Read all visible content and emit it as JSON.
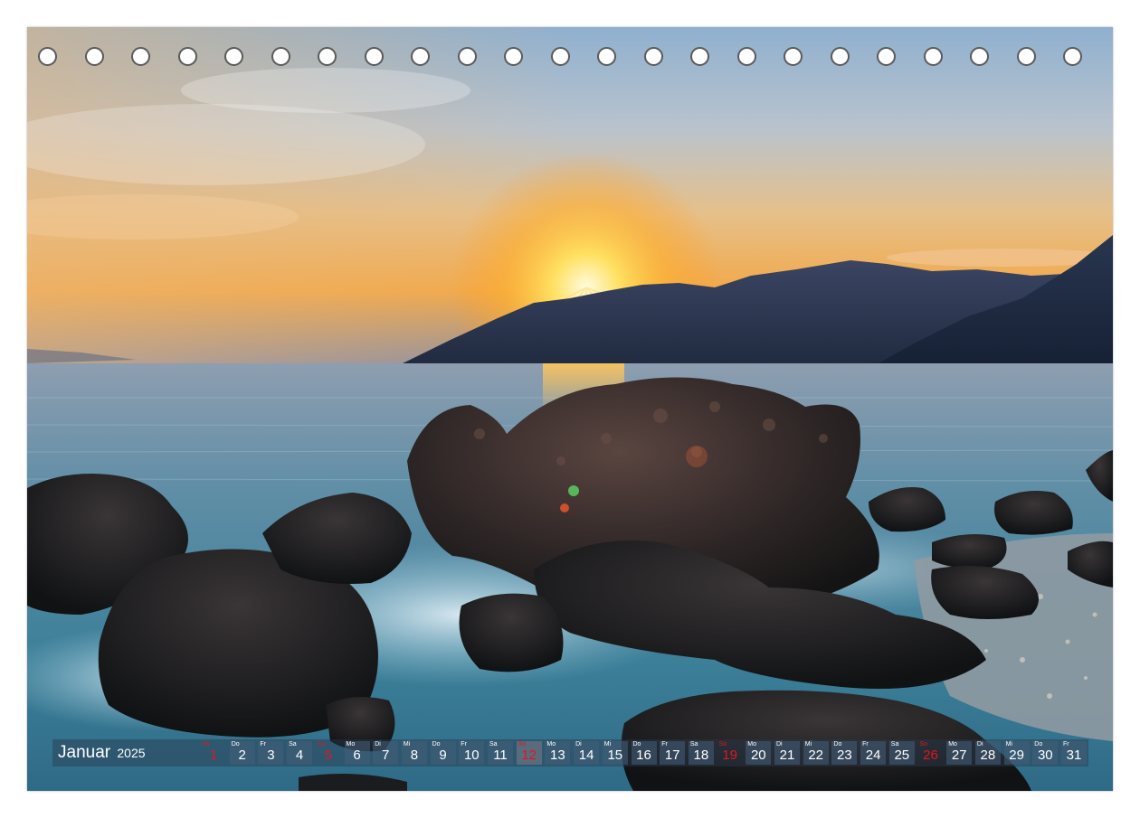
{
  "calendar": {
    "month": "Januar",
    "year": "2025",
    "holes_count": 23,
    "accent_color": "#e3161b",
    "days": [
      {
        "wd": "Mi",
        "n": "1",
        "type": "sunday"
      },
      {
        "wd": "Do",
        "n": "2"
      },
      {
        "wd": "Fr",
        "n": "3"
      },
      {
        "wd": "Sa",
        "n": "4"
      },
      {
        "wd": "So",
        "n": "5",
        "type": "sunday"
      },
      {
        "wd": "Mo",
        "n": "6"
      },
      {
        "wd": "Di",
        "n": "7"
      },
      {
        "wd": "Mi",
        "n": "8"
      },
      {
        "wd": "Do",
        "n": "9"
      },
      {
        "wd": "Fr",
        "n": "10"
      },
      {
        "wd": "Sa",
        "n": "11"
      },
      {
        "wd": "So",
        "n": "12",
        "type": "hl"
      },
      {
        "wd": "Mo",
        "n": "13"
      },
      {
        "wd": "Di",
        "n": "14"
      },
      {
        "wd": "Mi",
        "n": "15"
      },
      {
        "wd": "Do",
        "n": "16"
      },
      {
        "wd": "Fr",
        "n": "17"
      },
      {
        "wd": "Sa",
        "n": "18"
      },
      {
        "wd": "So",
        "n": "19",
        "type": "sunday"
      },
      {
        "wd": "Mo",
        "n": "20"
      },
      {
        "wd": "Di",
        "n": "21"
      },
      {
        "wd": "Mi",
        "n": "22"
      },
      {
        "wd": "Do",
        "n": "23"
      },
      {
        "wd": "Fr",
        "n": "24"
      },
      {
        "wd": "Sa",
        "n": "25"
      },
      {
        "wd": "So",
        "n": "26",
        "type": "sunday"
      },
      {
        "wd": "Mo",
        "n": "27"
      },
      {
        "wd": "Di",
        "n": "28"
      },
      {
        "wd": "Mi",
        "n": "29"
      },
      {
        "wd": "Do",
        "n": "30"
      },
      {
        "wd": "Fr",
        "n": "31"
      }
    ]
  }
}
